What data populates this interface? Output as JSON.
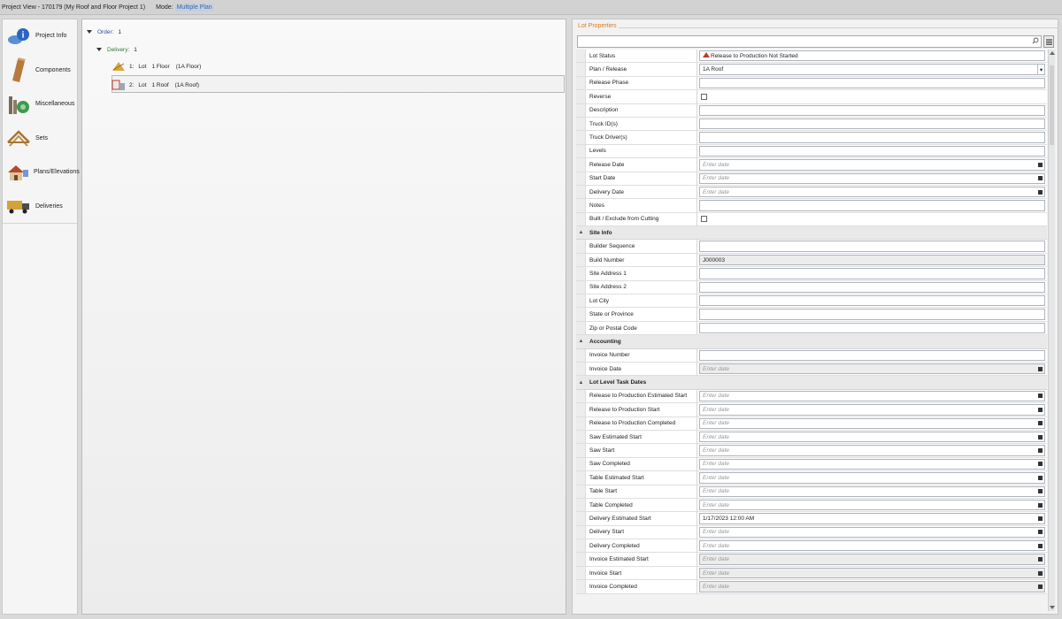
{
  "title": {
    "project": "Project View - 170179 (My Roof and Floor Project 1)",
    "mode_label": "Mode:",
    "mode_value": "Multiple Plan"
  },
  "sidebar": {
    "items": [
      {
        "label": "Project Info",
        "icon": "info-icon"
      },
      {
        "label": "Components",
        "icon": "lumber-icon"
      },
      {
        "label": "Miscellaneous",
        "icon": "misc-icon"
      },
      {
        "label": "Sets",
        "icon": "truss-set-icon"
      },
      {
        "label": "Plans/Elevations",
        "icon": "house-icon"
      },
      {
        "label": "Deliveries",
        "icon": "truck-icon"
      }
    ]
  },
  "tree": {
    "order_label": "Order:",
    "order_value": "1",
    "delivery_label": "Delivery:",
    "delivery_value": "1",
    "nodes": [
      {
        "num": "1:",
        "lot": "Lot",
        "lot_num": "1 Floor",
        "plan": "(1A Floor)"
      },
      {
        "num": "2:",
        "lot": "Lot",
        "lot_num": "1 Roof",
        "plan": "(1A Roof)"
      }
    ]
  },
  "props": {
    "title": "Lot Properties",
    "search_placeholder": "",
    "rows": [
      {
        "type": "row",
        "label": "Lot Status",
        "kind": "status",
        "value": "Release to Production Not Started"
      },
      {
        "type": "row",
        "label": "Plan / Release",
        "kind": "dropdown",
        "value": "1A Roof"
      },
      {
        "type": "row",
        "label": "Release Phase",
        "kind": "text",
        "value": ""
      },
      {
        "type": "row",
        "label": "Reverse",
        "kind": "check",
        "value": ""
      },
      {
        "type": "row",
        "label": "Description",
        "kind": "text",
        "value": ""
      },
      {
        "type": "row",
        "label": "Truck ID(s)",
        "kind": "text",
        "value": ""
      },
      {
        "type": "row",
        "label": "Truck Driver(s)",
        "kind": "text",
        "value": ""
      },
      {
        "type": "row",
        "label": "Levels",
        "kind": "text",
        "value": ""
      },
      {
        "type": "row",
        "label": "Release Date",
        "kind": "date",
        "value": "Enter date"
      },
      {
        "type": "row",
        "label": "Start Date",
        "kind": "date",
        "value": "Enter date"
      },
      {
        "type": "row",
        "label": "Delivery Date",
        "kind": "date",
        "value": "Enter date"
      },
      {
        "type": "row",
        "label": "Notes",
        "kind": "text",
        "value": ""
      },
      {
        "type": "row",
        "label": "Built / Exclude from Cutting",
        "kind": "check",
        "value": ""
      },
      {
        "type": "cat",
        "label": "Site Info"
      },
      {
        "type": "row",
        "label": "Builder Sequence",
        "kind": "text",
        "value": ""
      },
      {
        "type": "row",
        "label": "Build Number",
        "kind": "readonly",
        "value": "J000003"
      },
      {
        "type": "row",
        "label": "Site Address 1",
        "kind": "text",
        "value": ""
      },
      {
        "type": "row",
        "label": "Site Address 2",
        "kind": "text",
        "value": ""
      },
      {
        "type": "row",
        "label": "Lot City",
        "kind": "text",
        "value": ""
      },
      {
        "type": "row",
        "label": "State or Province",
        "kind": "text",
        "value": ""
      },
      {
        "type": "row",
        "label": "Zip or Postal Code",
        "kind": "text",
        "value": ""
      },
      {
        "type": "cat",
        "label": "Accounting"
      },
      {
        "type": "row",
        "label": "Invoice Number",
        "kind": "text",
        "value": ""
      },
      {
        "type": "row",
        "label": "Invoice Date",
        "kind": "dategrey",
        "value": "Enter date"
      },
      {
        "type": "cat",
        "label": "Lot Level Task Dates"
      },
      {
        "type": "row",
        "label": "Release to Production Estimated Start",
        "kind": "date",
        "value": "Enter date"
      },
      {
        "type": "row",
        "label": "Release to Production Start",
        "kind": "date",
        "value": "Enter date"
      },
      {
        "type": "row",
        "label": "Release to Production Completed",
        "kind": "date",
        "value": "Enter date"
      },
      {
        "type": "row",
        "label": "Saw Estimated Start",
        "kind": "date",
        "value": "Enter date"
      },
      {
        "type": "row",
        "label": "Saw Start",
        "kind": "date",
        "value": "Enter date"
      },
      {
        "type": "row",
        "label": "Saw Completed",
        "kind": "date",
        "value": "Enter date"
      },
      {
        "type": "row",
        "label": "Table Estimated Start",
        "kind": "date",
        "value": "Enter date"
      },
      {
        "type": "row",
        "label": "Table Start",
        "kind": "date",
        "value": "Enter date"
      },
      {
        "type": "row",
        "label": "Table Completed",
        "kind": "date",
        "value": "Enter date"
      },
      {
        "type": "row",
        "label": "Delivery Estimated Start",
        "kind": "dateval",
        "value": "1/17/2023 12:00 AM"
      },
      {
        "type": "row",
        "label": "Delivery Start",
        "kind": "date",
        "value": "Enter date"
      },
      {
        "type": "row",
        "label": "Delivery Completed",
        "kind": "date",
        "value": "Enter date"
      },
      {
        "type": "row",
        "label": "Invoice Estimated Start",
        "kind": "dategrey",
        "value": "Enter date"
      },
      {
        "type": "row",
        "label": "Invoice Start",
        "kind": "dategrey",
        "value": "Enter date"
      },
      {
        "type": "row",
        "label": "Invoice Completed",
        "kind": "dategrey",
        "value": "Enter date"
      }
    ]
  }
}
